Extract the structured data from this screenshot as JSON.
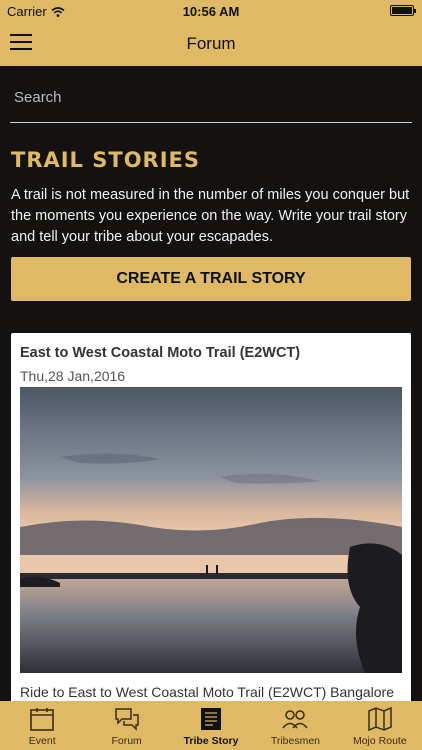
{
  "status_bar": {
    "carrier": "Carrier",
    "time": "10:56 AM"
  },
  "nav": {
    "title": "Forum",
    "menu_icon": "hamburger-icon"
  },
  "search": {
    "placeholder": "Search",
    "value": ""
  },
  "section": {
    "heading": "TRAIL STORIES",
    "intro": "A trail is not measured in the number of miles you conquer but the moments you experience on the way. Write your trail story and tell your tribe about your escapades."
  },
  "cta": {
    "label": "CREATE A TRAIL STORY"
  },
  "story": {
    "title": "East to West Coastal Moto Trail (E2WCT)",
    "date": "Thu,28 Jan,2016",
    "excerpt": "Ride to East to West Coastal Moto Trail (E2WCT) Bangalore"
  },
  "tabs": [
    {
      "label": "Event",
      "icon": "calendar-icon",
      "active": false
    },
    {
      "label": "Forum",
      "icon": "chat-bubbles-icon",
      "active": false
    },
    {
      "label": "Tribe Story",
      "icon": "book-icon",
      "active": true
    },
    {
      "label": "Tribesmen",
      "icon": "people-icon",
      "active": false
    },
    {
      "label": "Mojo Route",
      "icon": "map-icon",
      "active": false
    }
  ],
  "colors": {
    "accent": "#dfb965",
    "background": "#141210",
    "card": "#ffffff"
  }
}
